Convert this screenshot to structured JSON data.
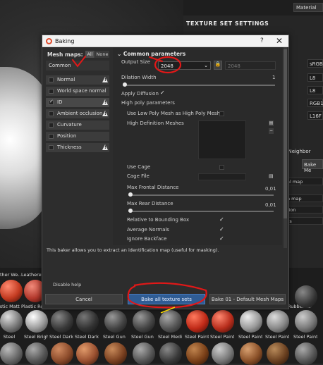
{
  "background_app": {
    "material_label": "Material",
    "texture_set_settings_title": "TEXTURE SET SETTINGS",
    "right_panel_values": [
      "sRGB8",
      "L8",
      "L8",
      "RGB16",
      "L16F"
    ],
    "neighbor_label": "e Neighbor",
    "bake_mesh_button": "Bake Me",
    "list_items": [
      "al map",
      "n map",
      "tion",
      "ss"
    ],
    "shelf": {
      "row1_labels": [
        "ather We...",
        "Leatherette",
        "",
        "",
        "",
        "",
        "",
        "",
        "",
        "",
        "",
        "Rubber Tire",
        ""
      ],
      "row2_labels": [
        "lastic Matte",
        "Plastic Rou...",
        "Plastic Rou...",
        "Plastic Rou...",
        "Plastic Rou...",
        "Plastic Soft...",
        "Plastic Soft...",
        "Plastic Stair...",
        "Plastic Stair...",
        "Plastic Shir...",
        "Plastic Shir...",
        "Rubber Tire",
        "Rubber ..."
      ],
      "row3_labels": [
        "Steel",
        "Steel Bright...",
        "Steel Dark ...",
        "Steel Dark ...",
        "Steel Gun ...",
        "Steel Gun ...",
        "Steel Medie...",
        "Steel Painted",
        "Steel Painte...",
        "Steel Painte...",
        "Steel Painte...",
        "Steel Painte..."
      ]
    }
  },
  "dialog": {
    "title": "Baking",
    "help": "?",
    "close": "✕",
    "mesh_maps_label": "Mesh maps:",
    "all_label": "All",
    "none_label": "None",
    "common_label": "Common",
    "maps": [
      {
        "label": "Normal",
        "checked": false,
        "warning": true
      },
      {
        "label": "World space normal",
        "checked": false,
        "warning": false
      },
      {
        "label": "ID",
        "checked": true,
        "warning": true
      },
      {
        "label": "Ambient occlusion",
        "checked": false,
        "warning": true
      },
      {
        "label": "Curvature",
        "checked": false,
        "warning": false
      },
      {
        "label": "Position",
        "checked": false,
        "warning": false
      },
      {
        "label": "Thickness",
        "checked": false,
        "warning": true
      }
    ],
    "section_title": "Common parameters",
    "output_size_label": "Output Size",
    "output_size_value": "2048",
    "output_size_linked": "2048",
    "dilation_width_label": "Dilation Width",
    "dilation_width_value": "1",
    "apply_diffusion_label": "Apply Diffusion",
    "high_poly_params_label": "High poly parameters",
    "use_low_poly_label": "Use Low Poly Mesh as High Poly Mesh",
    "high_def_meshes_label": "High Definition Meshes",
    "use_cage_label": "Use Cage",
    "cage_file_label": "Cage File",
    "max_frontal_label": "Max Frontal Distance",
    "max_frontal_value": "0,01",
    "max_rear_label": "Max Rear Distance",
    "max_rear_value": "0,01",
    "relative_bbox_label": "Relative to Bounding Box",
    "average_normals_label": "Average Normals",
    "ignore_backface_label": "Ignore Backface",
    "description": "This baker allows you to extract an identification map (useful for masking).",
    "disable_help": "Disable help",
    "cancel_label": "Cancel",
    "bake_all_label": "Bake all texture sets",
    "bake_one_label": "Bake 01 - Default Mesh Maps"
  }
}
